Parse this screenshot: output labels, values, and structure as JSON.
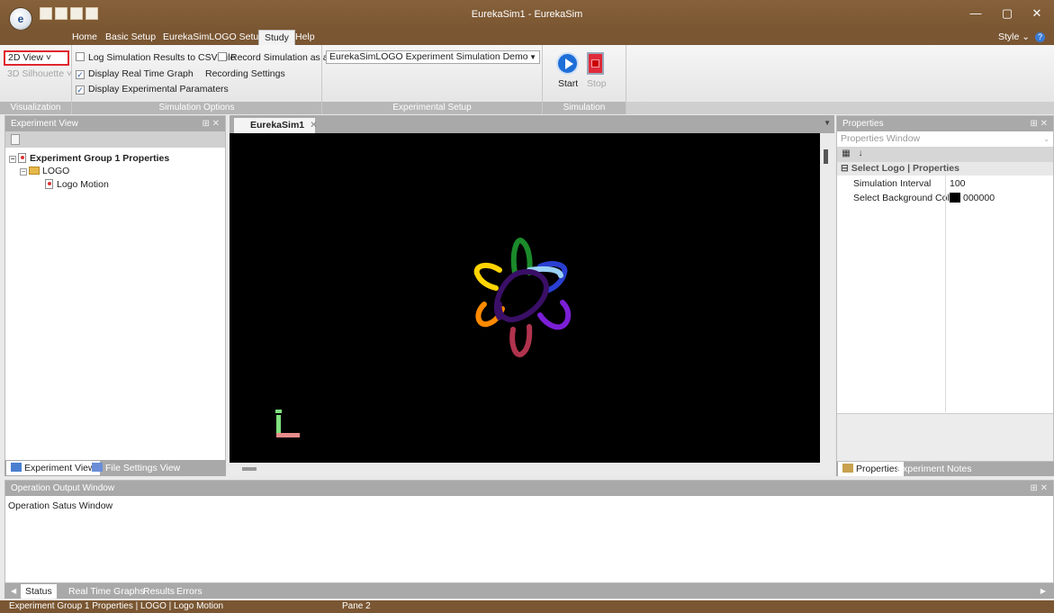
{
  "window": {
    "title": "EurekaSim1 - EurekaSim",
    "app_orb_text": "e",
    "controls": [
      "—",
      "▢",
      "✕"
    ]
  },
  "ribbon_tabs": [
    "Home",
    "Basic Setup",
    "EurekaSimLOGO Setup",
    "Study",
    "Help"
  ],
  "style_label": "Style",
  "ribbon": {
    "visualization": {
      "caption": "Visualization",
      "view_2d": "2D View",
      "view_3d": "3D Silhouette"
    },
    "simulation_options": {
      "caption": "Simulation Options",
      "log_csv": "Log Simulation Results to CSV File",
      "record_video": "Record Simulation as a Video",
      "display_graph": "Display Real Time Graph",
      "recording_settings": "Recording Settings",
      "display_params": "Display Experimental Paramaters"
    },
    "experimental_setup": {
      "caption": "Experimental Setup",
      "selected": "EurekaSimLOGO Experiment Simulation Demo"
    },
    "simulation_operations": {
      "caption": "Simulation Operations",
      "start": "Start",
      "stop": "Stop"
    }
  },
  "experiment_view": {
    "title": "Experiment View",
    "pin": "⊞ ✕",
    "tree": {
      "root": "Experiment Group 1 Properties",
      "folder": "LOGO",
      "leaf": "Logo Motion"
    },
    "bottom_tabs": [
      "Experiment View",
      "File Settings View"
    ]
  },
  "document": {
    "tab_label": "EurekaSim1",
    "tab_close": "✕",
    "logo_colors": [
      "#1b8a2a",
      "#2a3fd1",
      "#9ad1f5",
      "#7b1fd6",
      "#b0334d",
      "#ff8a00",
      "#ffd400",
      "#3a0f66"
    ]
  },
  "properties": {
    "title": "Properties",
    "pin": "⊞ ✕",
    "combo": "Properties Window",
    "category": "Select Logo | Properties",
    "rows": [
      {
        "name": "Simulation Interval",
        "value": "100"
      },
      {
        "name": "Select Background Color",
        "value": "000000"
      }
    ],
    "bottom_tabs": [
      "Properties",
      "Experiment Notes"
    ]
  },
  "output": {
    "title": "Operation Output Window",
    "pin": "⊞ ✕",
    "text": "Operation Satus Window",
    "tabs": [
      "Status",
      "Real Time Graphs",
      "Results",
      "Errors"
    ]
  },
  "status_bar": {
    "path": "Experiment Group 1 Properties | LOGO | Logo Motion",
    "pane": "Pane 2"
  }
}
